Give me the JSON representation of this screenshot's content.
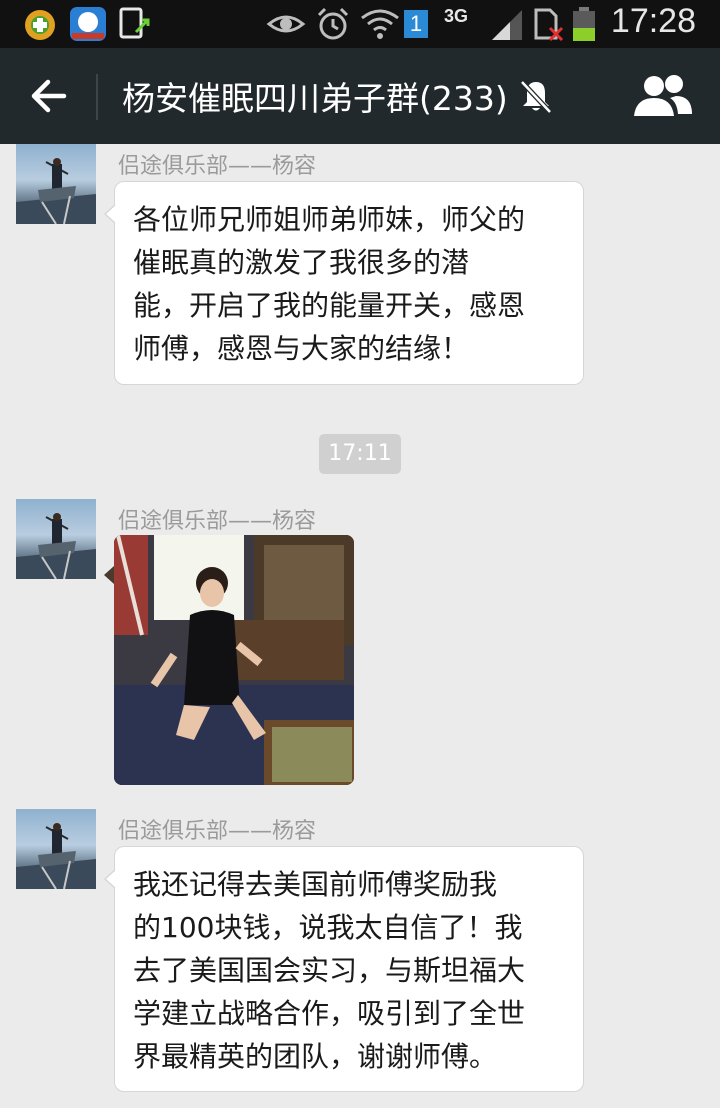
{
  "status_bar": {
    "time": "17:28",
    "network": "3G",
    "sim_badge": "1",
    "icons": [
      "app-icon-green",
      "app-icon-blue",
      "screenshot-icon",
      "eye-icon",
      "alarm-icon",
      "wifi-icon",
      "sim-badge-icon",
      "signal-icon",
      "sim-missing-icon",
      "battery-icon"
    ]
  },
  "header": {
    "title": "杨安催眠四川弟子群(233)",
    "icons": [
      "back-arrow-icon",
      "mute-bell-icon",
      "group-members-icon"
    ],
    "colors": {
      "background": "#22292c",
      "title": "#ffffff"
    }
  },
  "chat": {
    "messages": [
      {
        "sender": "侣途俱乐部——杨容",
        "type": "text",
        "lines": [
          "各位师兄师姐师弟师妹，师父的",
          "催眠真的激发了我很多的潜",
          "能，开启了我的能量开关，感恩",
          "师傅，感恩与大家的结缘！"
        ]
      },
      {
        "type": "timestamp",
        "text": "17:11"
      },
      {
        "sender": "侣途俱乐部——杨容",
        "type": "image"
      },
      {
        "sender": "侣途俱乐部——杨容",
        "type": "text",
        "lines": [
          "我还记得去美国前师傅奖励我",
          "的100块钱，说我太自信了！我",
          "去了美国国会实习，与斯坦福大",
          "学建立战略合作，吸引到了全世",
          "界最精英的团队，谢谢师傅。"
        ]
      }
    ]
  },
  "colors": {
    "chat_background": "#ebebeb",
    "bubble": "#ffffff",
    "sender_text": "#9b9b9b",
    "timestamp_chip": "#d0d0d0"
  }
}
